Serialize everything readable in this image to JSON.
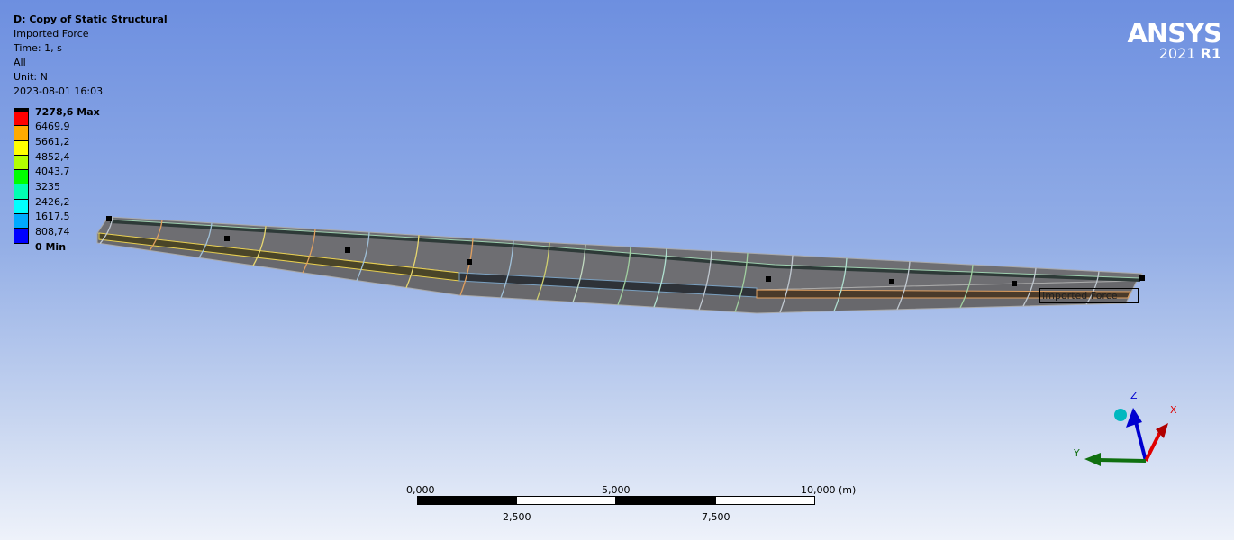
{
  "header": {
    "title": "D: Copy of Static Structural",
    "result": "Imported Force",
    "time": "Time: 1, s",
    "scope": "All",
    "unit": "Unit: N",
    "timestamp": "2023-08-01 16:03"
  },
  "legend": {
    "labels": [
      "7278,6 Max",
      "6469,9",
      "5661,2",
      "4852,4",
      "4043,7",
      "3235",
      "2426,2",
      "1617,5",
      "808,74",
      "0 Min"
    ],
    "colors": [
      "#ff0000",
      "#ffaa00",
      "#ffff00",
      "#b2ff00",
      "#00ff00",
      "#00ffb2",
      "#00ffff",
      "#00aaff",
      "#0000ff"
    ]
  },
  "logo": {
    "name": "ANSYS",
    "year": "2021",
    "release": "R1"
  },
  "annotation": {
    "label": "Imported Force"
  },
  "scale_bar": {
    "ticks_top": [
      "0,000",
      "5,000",
      "10,000 (m)"
    ],
    "ticks_bottom": [
      "2,500",
      "7,500"
    ]
  },
  "triad": {
    "x": "X",
    "y": "Y",
    "z": "Z",
    "colors": {
      "x": "#e00000",
      "y": "#107010",
      "z": "#0000d0",
      "iso": "#00b0b8"
    }
  }
}
